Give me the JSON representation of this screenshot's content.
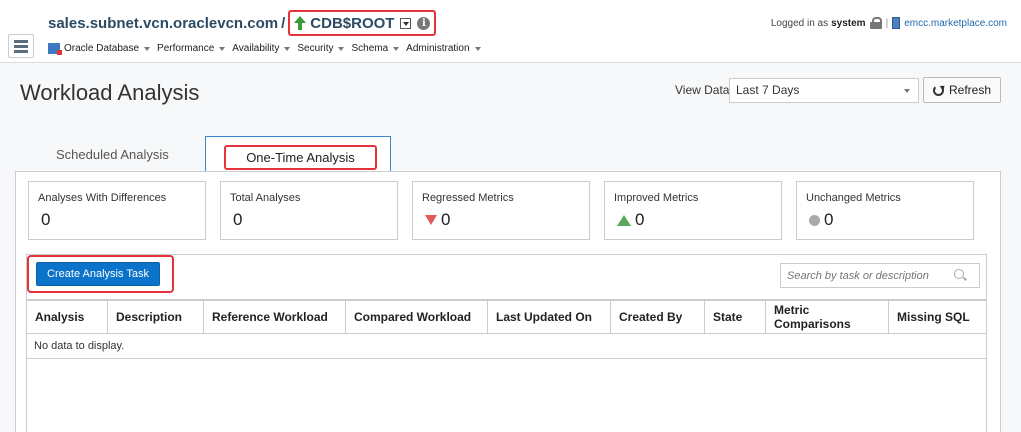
{
  "header": {
    "host": "sales.subnet.vcn.oraclevcn.com",
    "separator": "/",
    "target": "CDB$ROOT",
    "logged_in_label": "Logged in as",
    "user": "system",
    "server_link": "emcc.marketplace.com"
  },
  "nav": {
    "items": [
      "Oracle Database",
      "Performance",
      "Availability",
      "Security",
      "Schema",
      "Administration"
    ]
  },
  "page": {
    "title": "Workload Analysis",
    "view_data_label": "View Data",
    "view_data_value": "Last 7 Days",
    "refresh_label": "Refresh"
  },
  "tabs": {
    "scheduled": "Scheduled Analysis",
    "onetime": "One-Time Analysis"
  },
  "metrics": [
    {
      "label": "Analyses With Differences",
      "value": "0"
    },
    {
      "label": "Total Analyses",
      "value": "0"
    },
    {
      "label": "Regressed Metrics",
      "value": "0"
    },
    {
      "label": "Improved Metrics",
      "value": "0"
    },
    {
      "label": "Unchanged Metrics",
      "value": "0"
    }
  ],
  "toolbar": {
    "create_label": "Create Analysis Task",
    "search_placeholder": "Search by task or description"
  },
  "table": {
    "columns": [
      "Analysis",
      "Description",
      "Reference Workload",
      "Compared Workload",
      "Last Updated On",
      "Created By",
      "State",
      "Metric Comparisons",
      "Missing SQL"
    ],
    "empty_message": "No data to display."
  },
  "colors": {
    "highlight": "#e5323b",
    "primary": "#0b73c9",
    "status_up": "#3c9a3a"
  }
}
